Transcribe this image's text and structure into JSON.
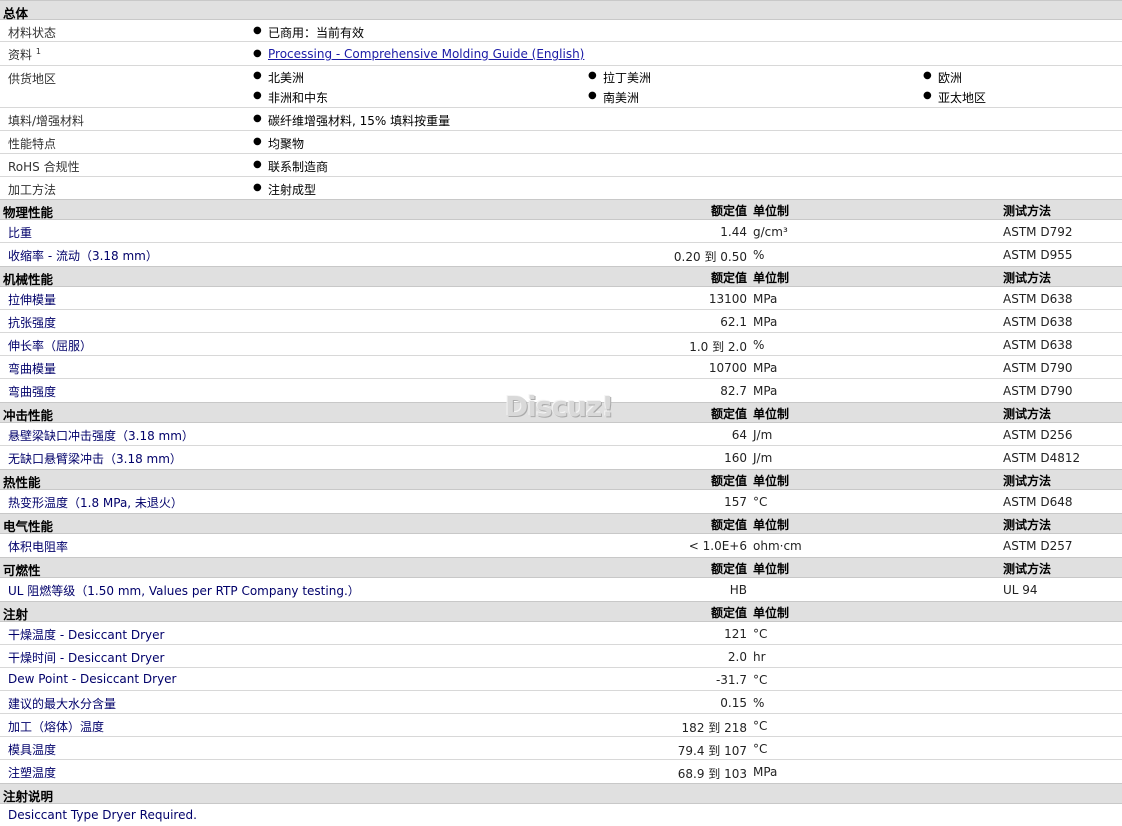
{
  "general": {
    "title": "总体",
    "status_label": "材料状态",
    "status_value": "已商用：当前有效",
    "docs_label": "资料",
    "docs_sup": "1",
    "docs_link": "Processing - Comprehensive Molding Guide (English)",
    "regions_label": "供货地区",
    "regions": [
      "北美洲",
      "拉丁美洲",
      "欧洲",
      "非洲和中东",
      "南美洲",
      "亚太地区"
    ],
    "filler_label": "填料/增强材料",
    "filler_value": "碳纤维增强材料, 15% 填料按重量",
    "features_label": "性能特点",
    "features_value": "均聚物",
    "rohs_label": "RoHS 合规性",
    "rohs_value": "联系制造商",
    "process_label": "加工方法",
    "process_value": "注射成型"
  },
  "headers": {
    "value": "额定值",
    "unit": "单位制",
    "method": "测试方法"
  },
  "physical": {
    "title": "物理性能",
    "rows": [
      {
        "label": "比重",
        "value": "1.44",
        "unit": "g/cm³",
        "method": "ASTM D792"
      },
      {
        "label": "收缩率 - 流动（3.18 mm）",
        "value": "0.20 到 0.50",
        "unit": "%",
        "method": "ASTM D955"
      }
    ]
  },
  "mechanical": {
    "title": "机械性能",
    "rows": [
      {
        "label": "拉伸模量",
        "value": "13100",
        "unit": "MPa",
        "method": "ASTM D638"
      },
      {
        "label": "抗张强度",
        "value": "62.1",
        "unit": "MPa",
        "method": "ASTM D638"
      },
      {
        "label": "伸长率（屈服）",
        "value": "1.0 到 2.0",
        "unit": "%",
        "method": "ASTM D638"
      },
      {
        "label": "弯曲模量",
        "value": "10700",
        "unit": "MPa",
        "method": "ASTM D790"
      },
      {
        "label": "弯曲强度",
        "value": "82.7",
        "unit": "MPa",
        "method": "ASTM D790"
      }
    ]
  },
  "impact": {
    "title": "冲击性能",
    "rows": [
      {
        "label": "悬壁梁缺口冲击强度（3.18 mm）",
        "value": "64",
        "unit": "J/m",
        "method": "ASTM D256"
      },
      {
        "label": "无缺口悬臂梁冲击（3.18 mm）",
        "value": "160",
        "unit": "J/m",
        "method": "ASTM D4812"
      }
    ]
  },
  "thermal": {
    "title": "热性能",
    "rows": [
      {
        "label": "热变形温度（1.8 MPa, 未退火）",
        "value": "157",
        "unit": "°C",
        "method": "ASTM D648"
      }
    ]
  },
  "electrical": {
    "title": "电气性能",
    "rows": [
      {
        "label": "体积电阻率",
        "value": "< 1.0E+6",
        "unit": "ohm·cm",
        "method": "ASTM D257"
      }
    ]
  },
  "flammability": {
    "title": "可燃性",
    "rows": [
      {
        "label": "UL 阻燃等级（1.50 mm, Values per RTP Company testing.）",
        "value": "HB",
        "unit": "",
        "method": "UL 94"
      }
    ]
  },
  "injection": {
    "title": "注射",
    "rows": [
      {
        "label": "干燥温度 - Desiccant Dryer",
        "value": "121",
        "unit": "°C"
      },
      {
        "label": "干燥时间 - Desiccant Dryer",
        "value": "2.0",
        "unit": "hr"
      },
      {
        "label": "Dew Point - Desiccant Dryer",
        "value": "-31.7",
        "unit": "°C"
      },
      {
        "label": "建议的最大水分含量",
        "value": "0.15",
        "unit": "%"
      },
      {
        "label": "加工（熔体）温度",
        "value": "182 到 218",
        "unit": "°C"
      },
      {
        "label": "模具温度",
        "value": "79.4 到 107",
        "unit": "°C"
      },
      {
        "label": "注塑温度",
        "value": "68.9 到 103",
        "unit": "MPa"
      }
    ]
  },
  "notes": {
    "title": "注射说明",
    "text": "Desiccant Type Dryer Required."
  },
  "watermark": "Discuz!"
}
